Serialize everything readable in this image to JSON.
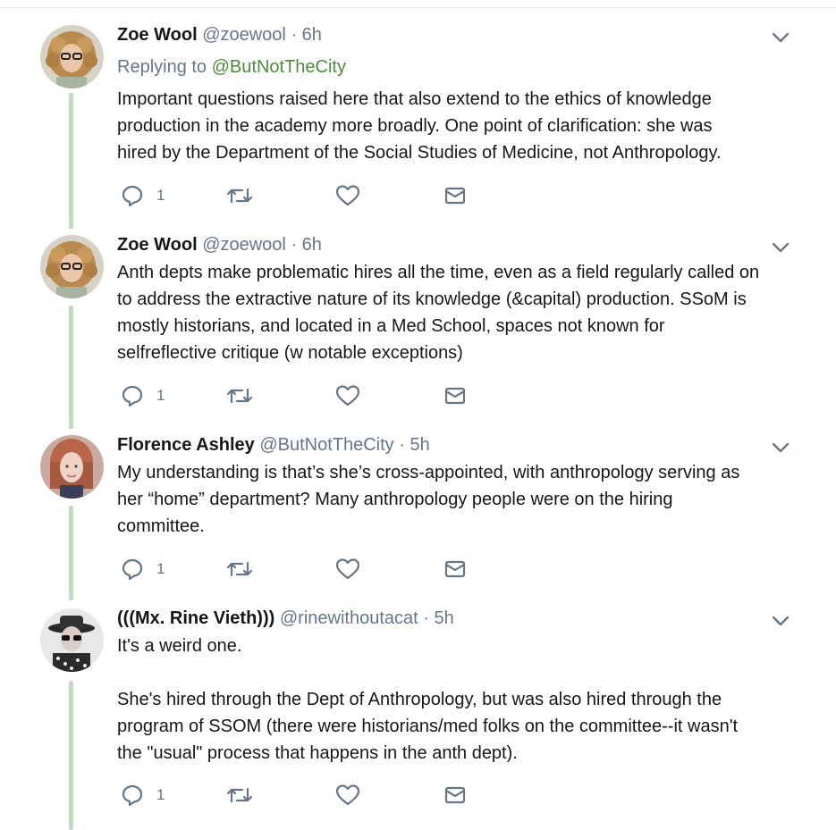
{
  "tweets": [
    {
      "name": "Zoe Wool",
      "handle": "@zoewool",
      "separator": "·",
      "time": "6h",
      "replying_prefix": "Replying to",
      "replying_to": "@ButNotTheCity",
      "lines": [
        "Important questions raised here that also extend to the ethics of knowledge",
        "production in the academy more broadly. One point of clarification: she was",
        "hired by the Department of the Social Studies of Medicine, not Anthropology."
      ],
      "reply_count": "1"
    },
    {
      "name": "Zoe Wool",
      "handle": "@zoewool",
      "separator": "·",
      "time": "6h",
      "lines": [
        "Anth depts make problematic hires all the time, even as a field regularly called on",
        "to address the extractive nature of its knowledge (&capital) production. SSoM is",
        "mostly historians, and located in a Med School, spaces not known for",
        "selfreflective critique (w notable exceptions)"
      ],
      "reply_count": "1"
    },
    {
      "name": "Florence Ashley",
      "handle": "@ButNotTheCity",
      "separator": "·",
      "time": "5h",
      "lines": [
        "My understanding is that’s she’s cross-appointed, with anthropology serving as",
        "her “home” department? Many anthropology people were on the hiring",
        "committee."
      ],
      "reply_count": "1"
    },
    {
      "name": "(((Mx. Rine Vieth)))",
      "handle": "@rinewithoutacat",
      "separator": "·",
      "time": "5h",
      "lines": [
        "It's a weird one.",
        "",
        "She's hired through the Dept of Anthropology, but was also hired through the",
        "program of SSOM (there were historians/med folks on the committee--it wasn't",
        "the \"usual\" process that happens in the anth dept)."
      ],
      "reply_count": "1"
    }
  ],
  "colors": {
    "text": "#14171a",
    "secondary": "#657786",
    "mention": "#4e8a3e",
    "thread_line": "#c4d9c2"
  },
  "icons": [
    "reply-icon",
    "retweet-icon",
    "like-icon",
    "message-icon",
    "chevron-down-icon"
  ]
}
